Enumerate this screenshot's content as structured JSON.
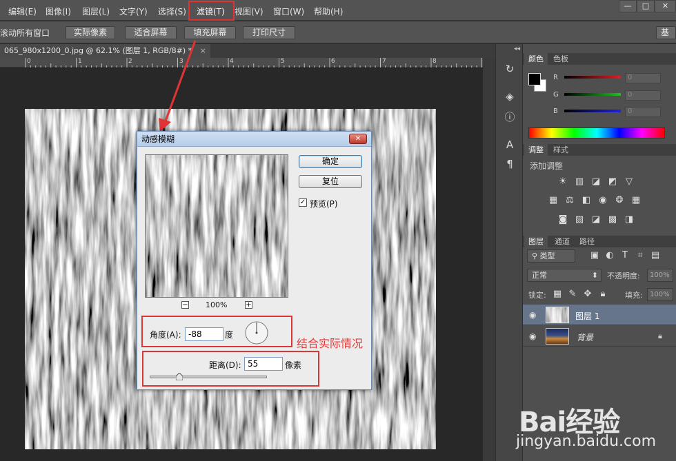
{
  "menu": {
    "items": [
      "编辑(E)",
      "图像(I)",
      "图层(L)",
      "文字(Y)",
      "选择(S)",
      "滤镜(T)",
      "视图(V)",
      "窗口(W)",
      "帮助(H)"
    ],
    "highlighted": "滤镜(T)"
  },
  "window_controls": {
    "minimize": "—",
    "restore": "□",
    "close": "✕"
  },
  "options_bar": {
    "scroll_all_label": "滚动所有窗口",
    "buttons": [
      "实际像素",
      "适合屏幕",
      "填充屏幕",
      "打印尺寸"
    ],
    "workspace_label": "基本"
  },
  "document": {
    "tab_title": "065_980x1200_0.jpg @ 62.1% (图层 1, RGB/8#) *",
    "tab_close": "×"
  },
  "ruler": {
    "ticks": [
      "0",
      "1",
      "2",
      "3",
      "4",
      "5",
      "6",
      "7",
      "8"
    ]
  },
  "tool_strip": {
    "collapse": "◂◂",
    "icons": [
      "history-icon",
      "3d-icon",
      "info-icon",
      "character-icon",
      "paragraph-icon"
    ]
  },
  "color_panel": {
    "tabs": [
      "颜色",
      "色板"
    ],
    "channels": [
      {
        "label": "R",
        "value": "0",
        "color": "#e02020"
      },
      {
        "label": "G",
        "value": "0",
        "color": "#20c020"
      },
      {
        "label": "B",
        "value": "0",
        "color": "#2020e0"
      }
    ]
  },
  "adjustments_panel": {
    "tabs": [
      "调整",
      "样式"
    ],
    "heading": "添加调整"
  },
  "layers_panel": {
    "tabs": [
      "图层",
      "通道",
      "路径"
    ],
    "filter_kind": "类型",
    "blend_mode": "正常",
    "opacity_label": "不透明度:",
    "opacity_value": "100%",
    "lock_label": "锁定:",
    "fill_label": "填充:",
    "fill_value": "100%",
    "layers": [
      {
        "name": "图层 1",
        "selected": true,
        "locked": false
      },
      {
        "name": "背景",
        "selected": false,
        "locked": true
      }
    ]
  },
  "dialog": {
    "title": "动感模糊",
    "close": "✕",
    "ok_label": "确定",
    "reset_label": "复位",
    "preview_label": "预览(P)",
    "preview_checked": true,
    "zoom_out": "−",
    "zoom_in": "+",
    "zoom_value": "100%",
    "angle_label": "角度(A):",
    "angle_value": "-88",
    "angle_unit": "度",
    "distance_label": "距离(D):",
    "distance_value": "55",
    "distance_unit": "像素",
    "distance_slider_level": 0.2
  },
  "annotation": {
    "text": "结合实际情况"
  },
  "watermark": {
    "brand": "Bai经验",
    "url": "jingyan.baidu.com"
  }
}
